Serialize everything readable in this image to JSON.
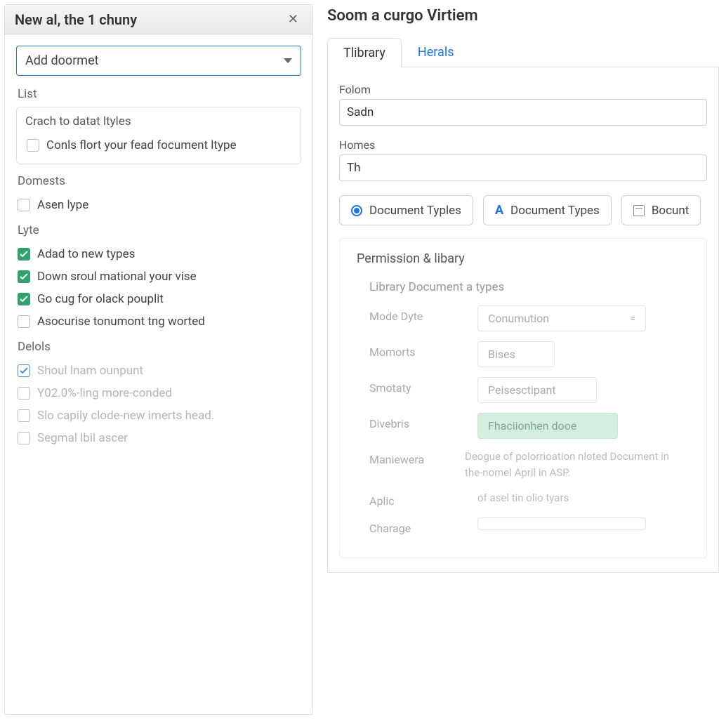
{
  "leftPanel": {
    "title": "New al, the 1 chuny",
    "selectLabel": "Add doormet",
    "sections": {
      "list": {
        "label": "List",
        "box": {
          "title": "Crach to datat ltyles",
          "item": "Conls flort your fead focument ltype"
        }
      },
      "domests": {
        "label": "Domests",
        "items": [
          {
            "label": "Asen lype",
            "checked": false
          }
        ]
      },
      "lyte": {
        "label": "Lyte",
        "items": [
          {
            "label": "Adad to new types",
            "checked": true,
            "style": "green"
          },
          {
            "label": "Down sroul mational your vise",
            "checked": true,
            "style": "green"
          },
          {
            "label": "Go cug for olack pouplit",
            "checked": true,
            "style": "green"
          },
          {
            "label": "Asocurise tonumont tng worted",
            "checked": false
          }
        ]
      },
      "delols": {
        "label": "Delols",
        "items": [
          {
            "label": "Shoul lnam ounpunt",
            "checked": true,
            "style": "blue",
            "dim": true
          },
          {
            "label": "Y02.0%-ling more-conded",
            "checked": false,
            "dim": true
          },
          {
            "label": "Slo capily clode-new imerts head.",
            "checked": false,
            "dim": true
          },
          {
            "label": "Segmal lbil ascer",
            "checked": false,
            "dim": true
          }
        ]
      }
    }
  },
  "rightPanel": {
    "title": "Soom a curgo Virtiem",
    "tabs": [
      {
        "label": "Tlibrary",
        "active": true
      },
      {
        "label": "Herals",
        "active": false
      }
    ],
    "fields": {
      "folom": {
        "label": "Folom",
        "value": "Sadn"
      },
      "homes": {
        "label": "Homes",
        "value": "Th"
      }
    },
    "typeButtons": [
      {
        "label": "Document Typles",
        "kind": "radio",
        "selected": true
      },
      {
        "label": "Document Types",
        "kind": "a"
      },
      {
        "label": "Bocunt",
        "kind": "cal"
      }
    ],
    "permission": {
      "title": "Permission & libary",
      "subtitle": "Library Document a types",
      "rows": [
        {
          "label": "Mode Dyte",
          "value": "Conumution",
          "type": "select"
        },
        {
          "label": "Momorts",
          "value": "Bises",
          "type": "pill"
        },
        {
          "label": "Smotaty",
          "value": "Peisesctipant",
          "type": "pill"
        },
        {
          "label": "Divebris",
          "value": "Fhaciionhen dooe",
          "type": "pillGreen"
        },
        {
          "label": "Maniewera",
          "value": "Deogue of polorrioation nloted Document in the-nomel April in ASP.",
          "type": "text"
        },
        {
          "label": "Aplic",
          "value": "of asel tin olio tyars",
          "type": "text"
        },
        {
          "label": "Charage",
          "value": "",
          "type": "select"
        }
      ]
    }
  }
}
